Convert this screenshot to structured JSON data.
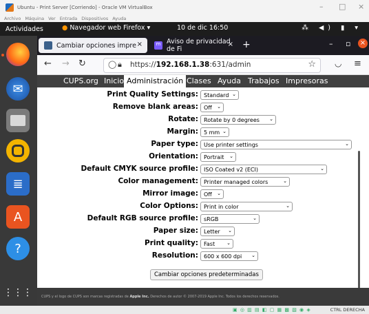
{
  "vbox": {
    "title": "Ubuntu - Print Server [Corriendo] - Oracle VM VirtualBox",
    "menu": [
      "Archivo",
      "Máquina",
      "Ver",
      "Entrada",
      "Dispositivos",
      "Ayuda"
    ],
    "minimize": "–",
    "maximize": "□",
    "close": "×",
    "host_key": "CTRL DERECHA",
    "status_icons": "▣ ◎ ▥ ▤ ◧ ▢ ▦ ▩ ▧ ◉ ◈"
  },
  "ubuntu": {
    "activities": "Actividades",
    "app_menu": "Navegador web Firefox ▾",
    "clock": "10 de dic  16:50",
    "tray": "⁂ ◀) ▮ ▾",
    "dock_icons": [
      "firefox-icon",
      "thunderbird-icon",
      "files-icon",
      "rhythmbox-icon",
      "writer-icon",
      "software-icon",
      "help-icon",
      "show-apps-icon"
    ]
  },
  "firefox": {
    "tabs": [
      {
        "label": "Cambiar opciones impre",
        "close": "×"
      },
      {
        "label": "Aviso de privacidad de Fi",
        "close": "×"
      }
    ],
    "new_tab": "+",
    "url_prefix": "https://",
    "url_host": "192.168.1.38",
    "url_suffix": ":631/admin",
    "window_controls": [
      "–",
      "▫",
      "×"
    ]
  },
  "cups": {
    "nav": [
      "CUPS.org",
      "Inicio",
      "Administración",
      "Clases",
      "Ayuda",
      "Trabajos",
      "Impresoras"
    ],
    "active_nav": "Administración",
    "options": [
      {
        "label": "Print Quality Settings:",
        "value": "Standard"
      },
      {
        "label": "Remove blank areas:",
        "value": "Off"
      },
      {
        "label": "Rotate:",
        "value": "Rotate by 0 degrees"
      },
      {
        "label": "Margin:",
        "value": "5 mm"
      },
      {
        "label": "Paper type:",
        "value": "Use printer settings"
      },
      {
        "label": "Orientation:",
        "value": "Portrait"
      },
      {
        "label": "Default CMYK source profile:",
        "value": "ISO Coated v2 (ECI)"
      },
      {
        "label": "Color management:",
        "value": "Printer managed colors"
      },
      {
        "label": "Mirror image:",
        "value": "Off"
      },
      {
        "label": "Color Options:",
        "value": "Print in color"
      },
      {
        "label": "Default RGB source profile:",
        "value": "sRGB"
      },
      {
        "label": "Paper size:",
        "value": "Letter"
      },
      {
        "label": "Print quality:",
        "value": "Fast"
      },
      {
        "label": "Resolution:",
        "value": "600 x 600 dpi"
      }
    ],
    "submit_label": "Cambiar opciones predeterminadas",
    "footer_pre": "CUPS y el logo de CUPS son marcas registradas de ",
    "footer_brand": "Apple Inc.",
    "footer_post": " Derechos de autor © 2007-2019 Apple Inc. Todos los derechos reservados."
  }
}
